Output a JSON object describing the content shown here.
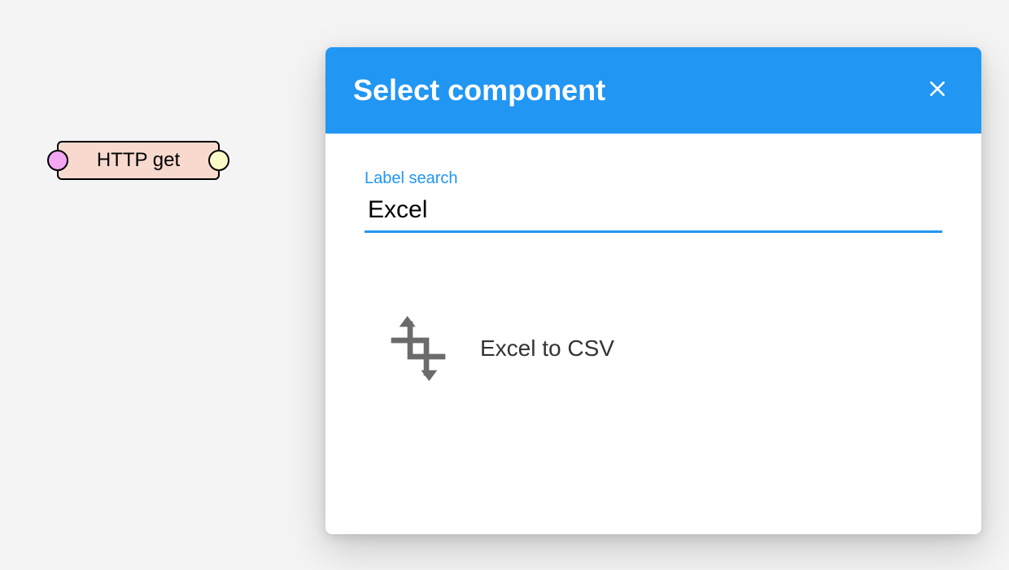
{
  "canvas": {
    "node": {
      "label": "HTTP get"
    }
  },
  "modal": {
    "title": "Select component",
    "search": {
      "label": "Label search",
      "value": "Excel"
    },
    "results": [
      {
        "label": "Excel to CSV",
        "icon": "transform-icon"
      }
    ]
  }
}
